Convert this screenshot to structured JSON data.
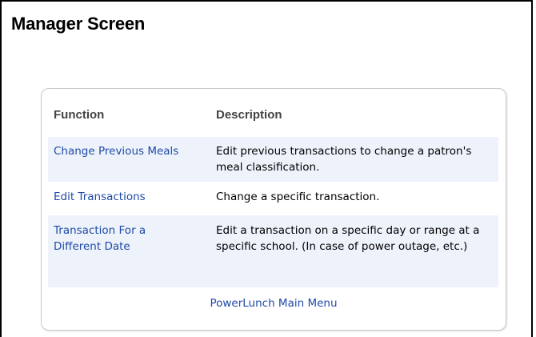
{
  "page": {
    "title": "Manager Screen"
  },
  "table": {
    "headers": {
      "function": "Function",
      "description": "Description"
    },
    "rows": [
      {
        "function": "Change Previous Meals",
        "description": "Edit previous transactions to change a patron's meal classification."
      },
      {
        "function": "Edit Transactions",
        "description": "Change a specific transaction."
      },
      {
        "function": "Transaction For a Different Date",
        "description": "Edit a transaction on a specific day or range at a specific school. (In case of power outage, etc.)"
      }
    ]
  },
  "footer": {
    "main_menu_link": "PowerLunch Main Menu"
  },
  "colors": {
    "link": "#1f4aa8",
    "row_alt_bg": "#eef2fb",
    "header_text": "#444444"
  }
}
